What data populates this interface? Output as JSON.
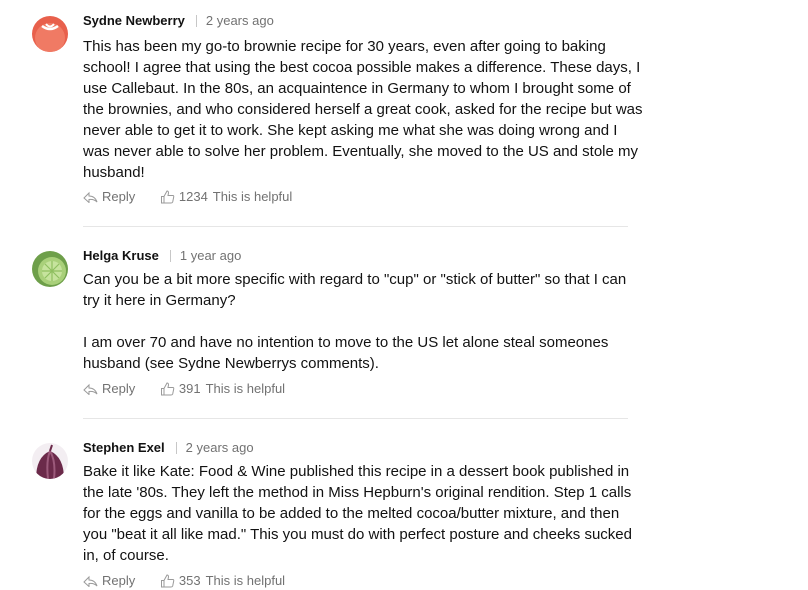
{
  "comments": [
    {
      "author": "Sydne Newberry",
      "time": "2 years ago",
      "paragraphs": [
        "This has been my go-to brownie recipe for 30 years, even after going to baking school! I agree that using the best cocoa possible makes a difference. These days, I use Callebaut. In the 80s, an acquaintence in Germany to whom I brought some of the brownies, and who considered herself a great cook, asked for the recipe but was never able to get it to work. She kept asking me what she was doing wrong and I was never able to solve her problem. Eventually, she moved to the US and stole my husband!"
      ],
      "reply_label": "Reply",
      "helpful_count": "1234",
      "helpful_label": "This is helpful",
      "avatar_icon": "tomato-icon",
      "avatar_color": "#e8604c"
    },
    {
      "author": "Helga Kruse",
      "time": "1 year ago",
      "paragraphs": [
        "Can you be a bit more specific with regard to \"cup\" or \"stick of butter\" so that I can try it here in Germany?",
        "I am over 70 and have no intention to move to the US let alone steal someones husband (see Sydne Newberrys comments)."
      ],
      "reply_label": "Reply",
      "helpful_count": "391",
      "helpful_label": "This is helpful",
      "avatar_icon": "lime-icon",
      "avatar_color": "#7fb356"
    },
    {
      "author": "Stephen Exel",
      "time": "2 years ago",
      "paragraphs": [
        "Bake it like Kate: Food & Wine published this recipe in a dessert book published in the late '80s. They left the method in Miss Hepburn's original rendition. Step 1 calls for the eggs and vanilla to be added to the melted cocoa/butter mixture, and then you \"beat it all like mad.\" This you must do with perfect posture and cheeks sucked in, of course."
      ],
      "reply_label": "Reply",
      "helpful_count": "353",
      "helpful_label": "This is helpful",
      "avatar_icon": "onion-icon",
      "avatar_color": "#6b2a4a"
    }
  ]
}
